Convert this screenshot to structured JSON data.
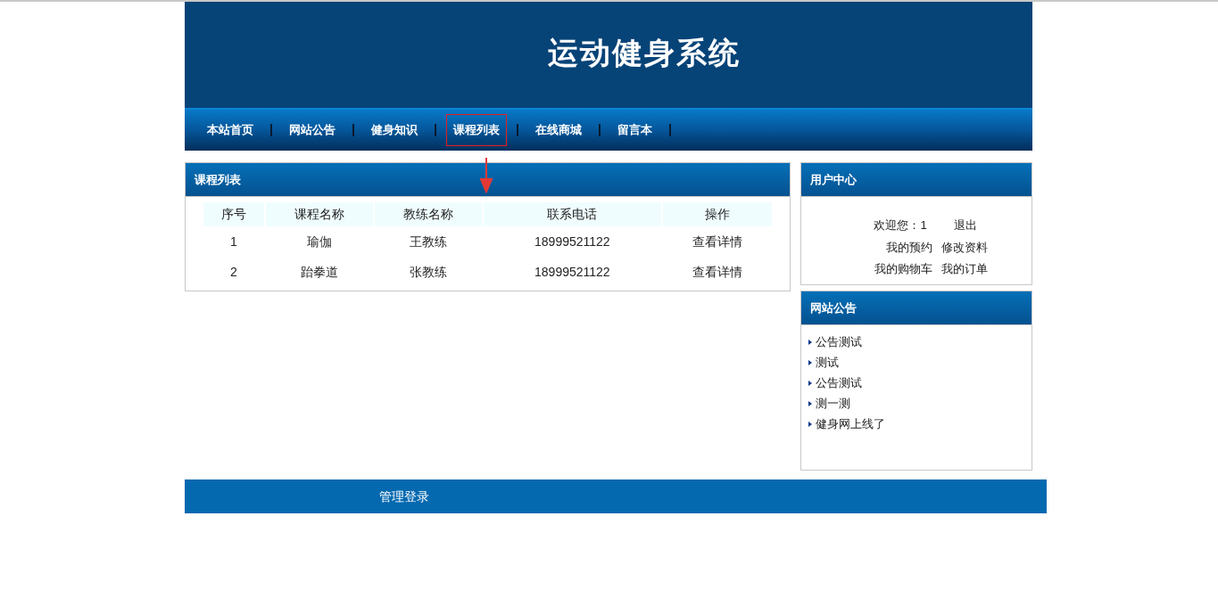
{
  "header": {
    "title": "运动健身系统"
  },
  "nav": [
    {
      "label": "本站首页",
      "selected": false
    },
    {
      "label": "网站公告",
      "selected": false
    },
    {
      "label": "健身知识",
      "selected": false
    },
    {
      "label": "课程列表",
      "selected": true
    },
    {
      "label": "在线商城",
      "selected": false
    },
    {
      "label": "留言本",
      "selected": false
    }
  ],
  "course_panel": {
    "title": "课程列表",
    "columns": [
      "序号",
      "课程名称",
      "教练名称",
      "联系电话",
      "操作"
    ],
    "rows": [
      [
        "1",
        "瑜伽",
        "王教练",
        "18999521122",
        "查看详情"
      ],
      [
        "2",
        "跆拳道",
        "张教练",
        "18999521122",
        "查看详情"
      ]
    ]
  },
  "user_center": {
    "title": "用户中心",
    "welcome": "欢迎您：1",
    "logout": "退出",
    "links": [
      [
        "我的预约",
        "修改资料"
      ],
      [
        "我的购物车",
        "我的订单"
      ]
    ]
  },
  "notices": {
    "title": "网站公告",
    "items": [
      "公告测试",
      "测试",
      "公告测试",
      "测一测",
      "健身网上线了"
    ]
  },
  "footer": {
    "link": "管理登录"
  }
}
